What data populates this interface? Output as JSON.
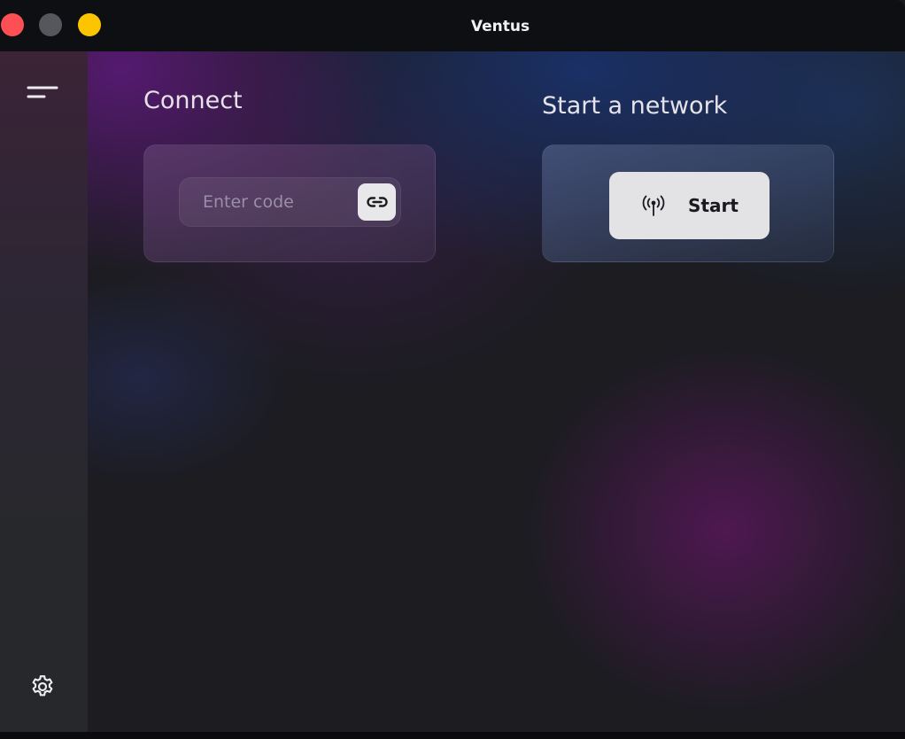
{
  "window": {
    "title": "Ventus"
  },
  "sidebar": {
    "menu_icon": "menu-icon",
    "settings_icon": "gear-icon"
  },
  "connect": {
    "heading": "Connect",
    "code_placeholder": "Enter code",
    "code_value": "",
    "link_icon": "link-icon"
  },
  "network": {
    "heading": "Start a network",
    "start_label": "Start",
    "start_icon": "antenna-icon"
  },
  "colors": {
    "close": "#fe4f54",
    "minimize": "#56575c",
    "maximize": "#fdc500",
    "button_bg": "#e3e3e6"
  }
}
